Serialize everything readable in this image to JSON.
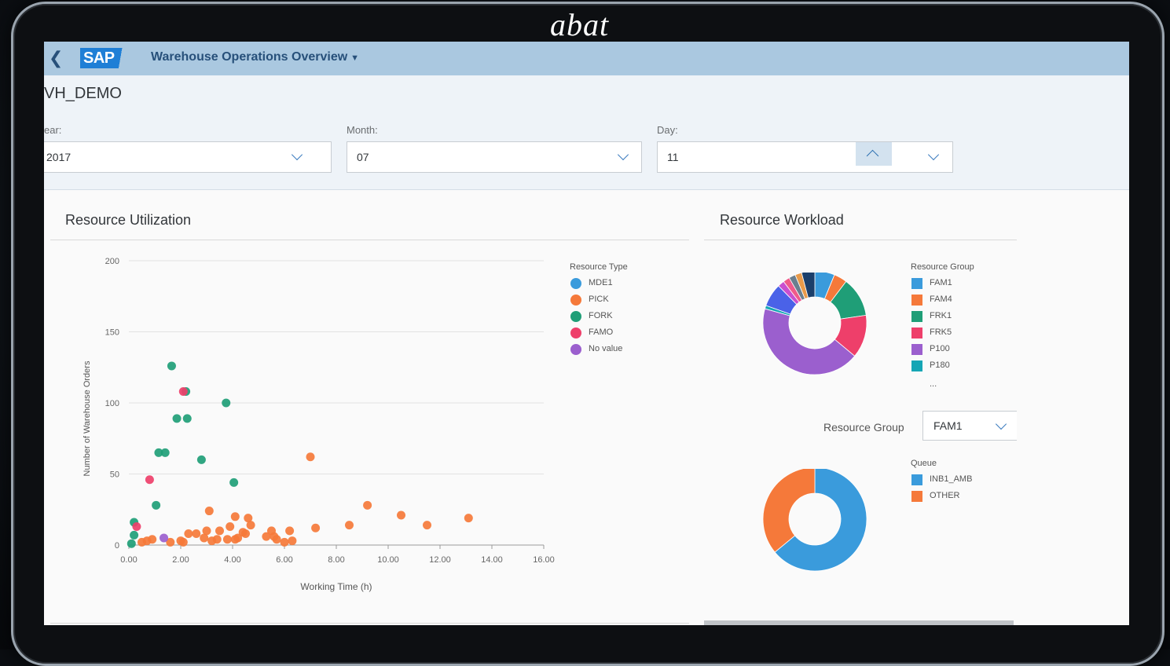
{
  "brand": "abat",
  "shell": {
    "app_title": "Warehouse Operations Overview",
    "back_icon": "chevron-left-icon",
    "logo_text": "SAP"
  },
  "header": {
    "title": "VH_DEMO",
    "filters": [
      {
        "label": "ear:",
        "value": "2017"
      },
      {
        "label": "Month:",
        "value": "07"
      },
      {
        "label": "Day:",
        "value": "11"
      }
    ]
  },
  "resource_utilization": {
    "title": "Resource Utilization",
    "legend_title": "Resource Type",
    "legend": [
      {
        "label": "MDE1",
        "color": "#3a9bdc"
      },
      {
        "label": "PICK",
        "color": "#f5793a"
      },
      {
        "label": "FORK",
        "color": "#1f9e77"
      },
      {
        "label": "FAMO",
        "color": "#ee3f6a"
      },
      {
        "label": "No value",
        "color": "#9b5fce"
      }
    ]
  },
  "resource_workload": {
    "title": "Resource Workload",
    "legend_title": "Resource Group",
    "legend": [
      {
        "label": "FAM1",
        "color": "#3a9bdc"
      },
      {
        "label": "FAM4",
        "color": "#f5793a"
      },
      {
        "label": "FRK1",
        "color": "#1f9e77"
      },
      {
        "label": "FRK5",
        "color": "#ee3f6a"
      },
      {
        "label": "P100",
        "color": "#9b5fce"
      },
      {
        "label": "P180",
        "color": "#15a6b5"
      }
    ],
    "legend_more": "...",
    "group_label": "Resource Group",
    "group_value": "FAM1",
    "queue_title": "Queue",
    "queue_legend": [
      {
        "label": "INB1_AMB",
        "color": "#3a9bdc"
      },
      {
        "label": "OTHER",
        "color": "#f5793a"
      }
    ]
  },
  "chart_data": [
    {
      "type": "scatter",
      "title": "",
      "xlabel": "Working Time (h)",
      "ylabel": "Number of Warehouse Orders",
      "xlim": [
        0,
        16
      ],
      "ylim": [
        0,
        200
      ],
      "x_ticks": [
        "0.00",
        "2.00",
        "4.00",
        "6.00",
        "8.00",
        "10.00",
        "12.00",
        "14.00",
        "16.00"
      ],
      "y_ticks": [
        "0",
        "50",
        "100",
        "150",
        "200"
      ],
      "grid": true,
      "legend_position": "right",
      "series": [
        {
          "name": "FORK",
          "color": "#1f9e77",
          "points": [
            [
              1.65,
              126
            ],
            [
              2.2,
              108
            ],
            [
              1.85,
              89
            ],
            [
              2.25,
              89
            ],
            [
              3.75,
              100
            ],
            [
              1.15,
              65
            ],
            [
              1.4,
              65
            ],
            [
              2.8,
              60
            ],
            [
              4.05,
              44
            ],
            [
              1.05,
              28
            ],
            [
              0.2,
              16
            ],
            [
              0.2,
              7
            ],
            [
              0.1,
              1
            ]
          ]
        },
        {
          "name": "FAMO",
          "color": "#ee3f6a",
          "points": [
            [
              2.1,
              108
            ],
            [
              0.8,
              46
            ],
            [
              0.3,
              13
            ]
          ]
        },
        {
          "name": "No value",
          "color": "#9b5fce",
          "points": [
            [
              1.35,
              5
            ]
          ]
        },
        {
          "name": "PICK",
          "color": "#f5793a",
          "points": [
            [
              7.0,
              62
            ],
            [
              9.2,
              28
            ],
            [
              10.5,
              21
            ],
            [
              11.5,
              14
            ],
            [
              13.1,
              19
            ],
            [
              8.5,
              14
            ],
            [
              7.2,
              12
            ],
            [
              3.1,
              24
            ],
            [
              4.1,
              20
            ],
            [
              4.6,
              19
            ],
            [
              4.7,
              14
            ],
            [
              3.9,
              13
            ],
            [
              3.0,
              10
            ],
            [
              2.3,
              8
            ],
            [
              2.6,
              8
            ],
            [
              3.5,
              10
            ],
            [
              4.4,
              9
            ],
            [
              4.5,
              8
            ],
            [
              5.5,
              10
            ],
            [
              6.2,
              10
            ],
            [
              2.0,
              3
            ],
            [
              2.9,
              5
            ],
            [
              3.4,
              4
            ],
            [
              3.8,
              4
            ],
            [
              4.2,
              5
            ],
            [
              5.3,
              6
            ],
            [
              5.7,
              4
            ],
            [
              6.3,
              3
            ],
            [
              0.5,
              2
            ],
            [
              0.7,
              3
            ],
            [
              0.9,
              4
            ],
            [
              1.6,
              2
            ],
            [
              2.1,
              2
            ],
            [
              3.2,
              3
            ],
            [
              4.1,
              4
            ],
            [
              5.6,
              6
            ],
            [
              6.0,
              2
            ]
          ]
        }
      ]
    },
    {
      "type": "pie",
      "title": "",
      "legend_title": "Resource Group",
      "slices": [
        {
          "label": "FAM1",
          "value": 6,
          "color": "#3a9bdc"
        },
        {
          "label": "FAM4",
          "value": 4,
          "color": "#f5793a"
        },
        {
          "label": "FRK1",
          "value": 12,
          "color": "#1f9e77"
        },
        {
          "label": "FRK5",
          "value": 13,
          "color": "#ee3f6a"
        },
        {
          "label": "P100",
          "value": 42,
          "color": "#9b5fce"
        },
        {
          "label": "P180",
          "value": 1,
          "color": "#15a6b5"
        },
        {
          "label": "",
          "value": 7,
          "color": "#4a62e8"
        },
        {
          "label": "",
          "value": 2,
          "color": "#c94fcf"
        },
        {
          "label": "",
          "value": 2,
          "color": "#f05a8a"
        },
        {
          "label": "",
          "value": 2,
          "color": "#6b7f8f"
        },
        {
          "label": "",
          "value": 2,
          "color": "#e89a4a"
        },
        {
          "label": "",
          "value": 4,
          "color": "#1b3f6b"
        }
      ]
    },
    {
      "type": "pie",
      "title": "",
      "legend_title": "Queue",
      "slices": [
        {
          "label": "INB1_AMB",
          "value": 64,
          "color": "#3a9bdc"
        },
        {
          "label": "OTHER",
          "value": 36,
          "color": "#f5793a"
        }
      ]
    }
  ]
}
